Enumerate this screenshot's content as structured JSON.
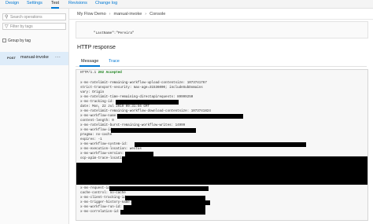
{
  "top_tabs": [
    "Design",
    "Settings",
    "Test",
    "Revisions",
    "Change log"
  ],
  "sidebar": {
    "search_placeholder": "Search operations",
    "filter_placeholder": "Filter by tags",
    "group_by_tag_label": "Group by tag",
    "operation": {
      "method": "POST",
      "name": "manual-invoke",
      "more": "..."
    }
  },
  "breadcrumb": [
    "My Flow Demo",
    "manual-invoke",
    "Console"
  ],
  "request_body": [
    "\"LastName\":\"Pereira\"",
    "}"
  ],
  "http_response_title": "HTTP response",
  "response_tabs": [
    "Message",
    "Trace"
  ],
  "response": {
    "status_prefix": "HTTP/1.1",
    "status": "202 Accepted",
    "lines": [
      "",
      "x-ms-ratelimit-remaining-workflow-upload-contentsize: 1073741767",
      "strict-transport-security: max-age=31536000; includeSubDomains",
      "vary: Origin",
      "x-ms-ratelimit-time-remaining-directapirequests: 89999250",
      "x-ms-tracking-id:",
      "date: Mon, 22 Jul 2019 09:31:56 GMT",
      "x-ms-ratelimit-remaining-workflow-download-contentsize: 1073741824",
      "x-ms-workflow-name:",
      "content-length: 0",
      "x-ms-ratelimit-burst-remaining-workflow-writes: 14999",
      "x-ms-workflow-id:",
      "pragma: no-cache",
      "expires: -1",
      "x-ms-workflow-system-id:",
      "x-ms-execution-location: westus",
      "x-ms-workflow-version:",
      "ocp-apim-trace-location:",
      "",
      "",
      "x-ms-request-id:",
      "cache-control: no-cache",
      "x-ms-client-tracking-id:",
      "x-ms-trigger-history-name:",
      "x-ms-workflow-run-id:",
      "x-ms-correlation-id:"
    ]
  }
}
